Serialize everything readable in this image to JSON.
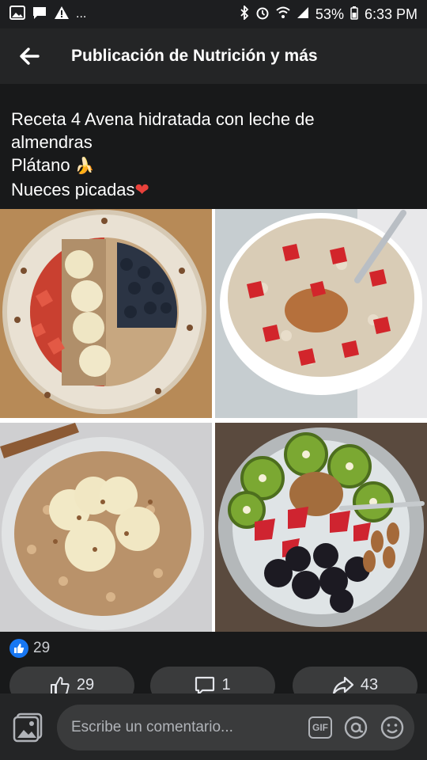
{
  "status_bar": {
    "left_glyphs": [
      "image-icon",
      "chat-icon",
      "warning-icon"
    ],
    "more": "...",
    "battery": "53%",
    "time": "6:33 PM"
  },
  "header": {
    "title": "Publicación de Nutrición y más"
  },
  "post": {
    "line1": "Receta 4 Avena hidratada con leche de",
    "line2": "almendras",
    "line3": "Plátano",
    "line3_emoji": "🍌",
    "line4": "Nueces picadas",
    "line4_emoji": "❤"
  },
  "photos": [
    {
      "subject": "oatmeal-bowl-strawberries-banana-blueberries"
    },
    {
      "subject": "oatmeal-bowl-strawberries-peanut-butter"
    },
    {
      "subject": "oatmeal-bowl-banana-nuts"
    },
    {
      "subject": "yogurt-bowl-kiwi-strawberries-blackberries-almonds"
    }
  ],
  "reactions": {
    "count": "29"
  },
  "actions": {
    "like_count": "29",
    "comment_count": "1",
    "share_count": "43"
  },
  "composer": {
    "placeholder": "Escribe un comentario...",
    "gif_label": "GIF"
  },
  "colors": {
    "background": "#18191a",
    "header": "#242526",
    "accent": "#1877f2"
  }
}
